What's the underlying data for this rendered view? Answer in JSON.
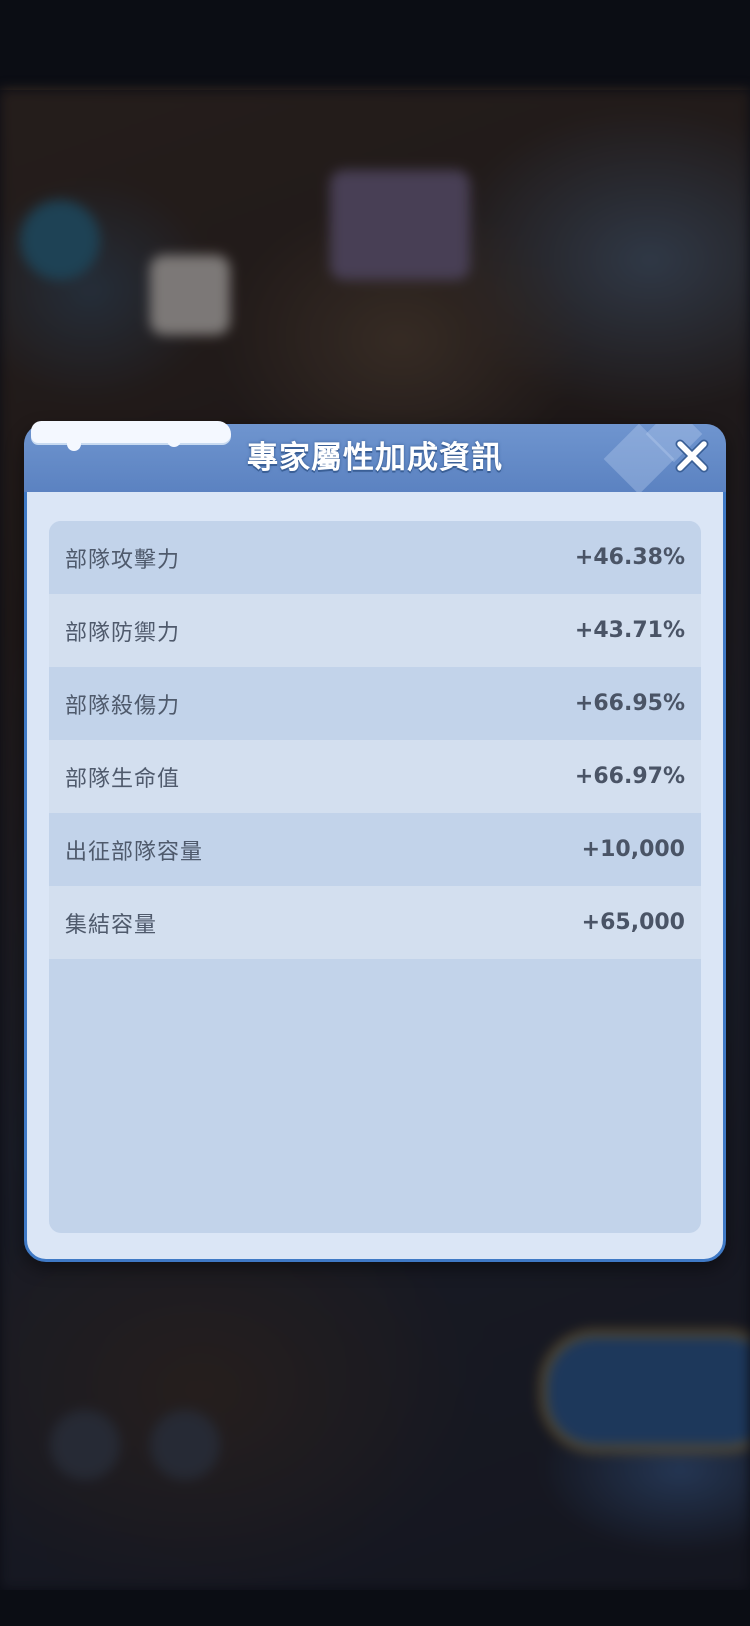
{
  "dialog": {
    "title": "專家屬性加成資訊",
    "close_icon": "close-icon"
  },
  "stats": [
    {
      "label": "部隊攻擊力",
      "value": "+46.38%"
    },
    {
      "label": "部隊防禦力",
      "value": "+43.71%"
    },
    {
      "label": "部隊殺傷力",
      "value": "+66.95%"
    },
    {
      "label": "部隊生命值",
      "value": "+66.97%"
    },
    {
      "label": "出征部隊容量",
      "value": "+10,000"
    },
    {
      "label": "集結容量",
      "value": "+65,000"
    }
  ],
  "colors": {
    "header": "#5b82c1",
    "dialog_bg": "#dbe6f6",
    "border": "#3f79c5",
    "row_dark": "#c2d3ea",
    "row_light": "#d3dfef",
    "text": "#4f5a6c"
  }
}
